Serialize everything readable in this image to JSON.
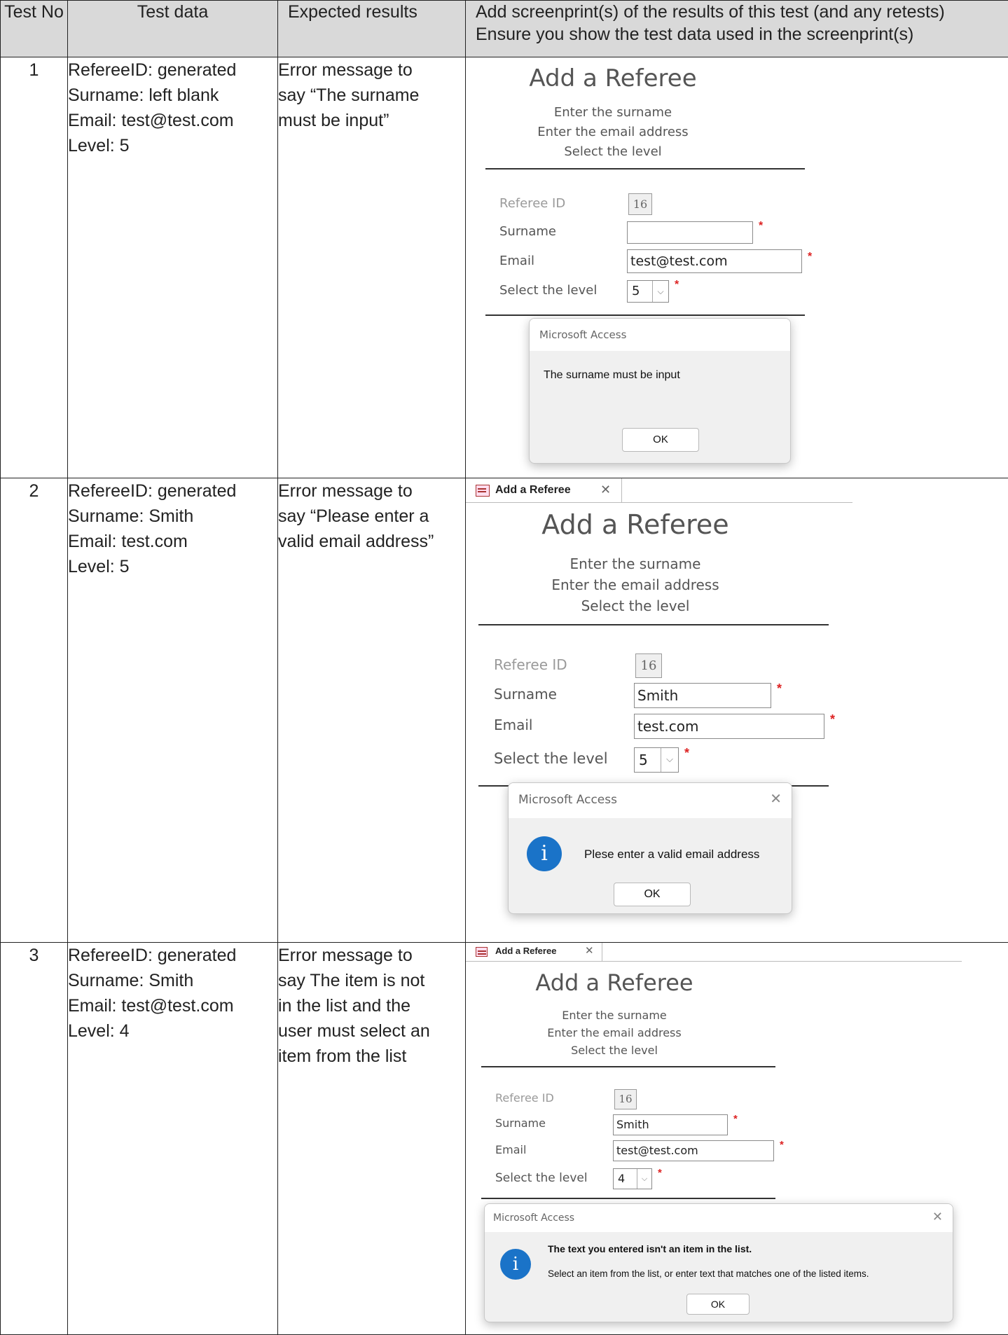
{
  "headers": {
    "test_no": "Test No",
    "test_data": "Test data",
    "expected": "Expected results",
    "screenprint_line1": "Add screenprint(s) of the results of this test (and any retests)",
    "screenprint_line2": "Ensure you show the test data used in the screenprint(s)"
  },
  "rows": [
    {
      "no": "1",
      "data": [
        "RefereeID: generated",
        "Surname: left blank",
        "Email: test@test.com",
        "Level: 5"
      ],
      "expected": [
        "Error message to",
        "say “The surname",
        "must be input”"
      ],
      "form": {
        "title": "Add a Referee",
        "instructions": [
          "Enter the surname",
          "Enter the email address",
          "Select the level"
        ],
        "referee_id_label": "Referee ID",
        "referee_id": "16",
        "surname_label": "Surname",
        "surname": "",
        "email_label": "Email",
        "email": "test@test.com",
        "level_label": "Select the level",
        "level": "5",
        "required_mark": "*"
      },
      "dialog": {
        "caption": "Microsoft Access",
        "message": "The surname must be input",
        "ok": "OK"
      }
    },
    {
      "no": "2",
      "data": [
        "RefereeID: generated",
        "Surname: Smith",
        "Email: test.com",
        "Level: 5"
      ],
      "expected": [
        "Error message to",
        "say “Please enter a",
        "valid email address”"
      ],
      "tab": {
        "name": "Add a Referee",
        "close": "✕"
      },
      "form": {
        "title": "Add a Referee",
        "instructions": [
          "Enter the surname",
          "Enter the email address",
          "Select the level"
        ],
        "referee_id_label": "Referee ID",
        "referee_id": "16",
        "surname_label": "Surname",
        "surname": "Smith",
        "email_label": "Email",
        "email": "test.com",
        "level_label": "Select the level",
        "level": "5",
        "required_mark": "*"
      },
      "dialog": {
        "caption": "Microsoft Access",
        "close": "✕",
        "icon": "i",
        "message": "Plese enter a valid email address",
        "ok": "OK"
      }
    },
    {
      "no": "3",
      "data": [
        "RefereeID: generated",
        "Surname: Smith",
        "Email: test@test.com",
        "Level: 4"
      ],
      "expected": [
        "Error message to",
        "say The item is not",
        "in the list and the",
        "user must select an",
        "item from the list"
      ],
      "tab": {
        "name": "Add a Referee",
        "close": "✕"
      },
      "form": {
        "title": "Add a Referee",
        "instructions": [
          "Enter the surname",
          "Enter the email address",
          "Select the level"
        ],
        "referee_id_label": "Referee ID",
        "referee_id": "16",
        "surname_label": "Surname",
        "surname": "Smith",
        "email_label": "Email",
        "email": "test@test.com",
        "level_label": "Select the level",
        "level": "4",
        "required_mark": "*"
      },
      "dialog": {
        "caption": "Microsoft Access",
        "close": "✕",
        "icon": "i",
        "message_line1": "The text you entered isn't an item in the list.",
        "message_line2": "Select an item from the list, or enter text that matches one of the listed items.",
        "ok": "OK"
      }
    }
  ],
  "icons": [
    "info-icon",
    "close-icon",
    "chevron-down-icon",
    "form-tab-icon"
  ],
  "colors": {
    "header_bg": "#d9d9d9",
    "required": "#dd2222",
    "info_icon": "#1a73c8"
  }
}
